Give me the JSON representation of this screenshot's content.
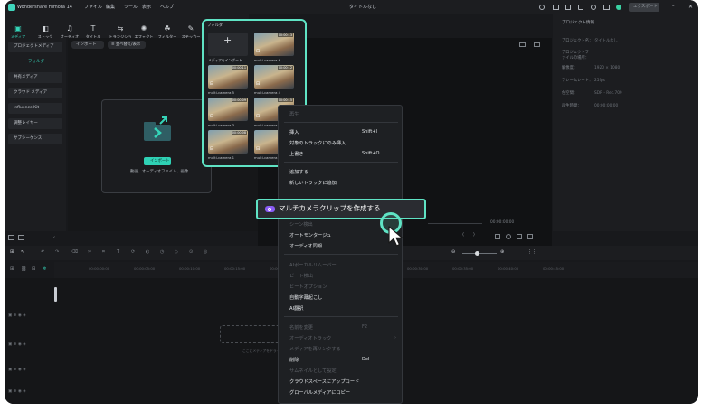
{
  "app": {
    "title": "Wondershare Filmora 14",
    "window_title": "タイトルなし",
    "export_label": "エクスポート"
  },
  "menubar": [
    "ファイル",
    "編集",
    "ツール",
    "表示",
    "ヘルプ"
  ],
  "toolbar": [
    {
      "label": "メディア",
      "icon": "media-icon",
      "glyph": "▣"
    },
    {
      "label": "ストック",
      "icon": "stock-icon",
      "glyph": "◧"
    },
    {
      "label": "オーディオ",
      "icon": "audio-icon",
      "glyph": "♫"
    },
    {
      "label": "タイトル",
      "icon": "title-icon",
      "glyph": "T"
    },
    {
      "label": "トランジション",
      "icon": "transition-icon",
      "glyph": "⇆"
    },
    {
      "label": "エフェクト",
      "icon": "effect-icon",
      "glyph": "✺"
    },
    {
      "label": "フィルター",
      "icon": "filter-icon",
      "glyph": "☘"
    },
    {
      "label": "ステッカー",
      "icon": "sticker-icon",
      "glyph": "✎"
    }
  ],
  "sidebar": {
    "items": [
      {
        "label": "プロジェクトメディア"
      },
      {
        "label": "フォルダ"
      },
      {
        "label": "共有メディア"
      },
      {
        "label": "クラウド メディア"
      },
      {
        "label": "Influence Kit"
      },
      {
        "label": "調整レイヤー"
      },
      {
        "label": "サブシーケンス"
      }
    ]
  },
  "media": {
    "import_chip": "インポート",
    "filter_chip": "≡ 並べ替え/表示",
    "import_button": "インポート",
    "drop_hint": "動画、オーディオファイル、画像"
  },
  "popup": {
    "header": "フォルダ",
    "import_label": "メディアをインポート",
    "thumbs": [
      {
        "label": "multi-camera 6",
        "duration": "00:00:13"
      },
      {
        "label": "multi-camera 5",
        "duration": "00:00:11"
      },
      {
        "label": "multi-camera 4",
        "duration": "00:00:12"
      },
      {
        "label": "multi-camera 3",
        "duration": "00:00:09"
      },
      {
        "label": "multi-camera 2",
        "duration": "00:00:15"
      },
      {
        "label": "multi-camera 1",
        "duration": "00:00:08"
      },
      {
        "label": "multi-camera",
        "duration": "00:00:10"
      }
    ]
  },
  "properties": {
    "header": "プロジェクト情報",
    "rows": [
      {
        "key": "プロジェクト名：",
        "value": "タイトルなし"
      },
      {
        "key": "プロジェクトファイルの場所：",
        "value": ""
      },
      {
        "key": "解像度：",
        "value": "1920 × 1080"
      },
      {
        "key": "フレームレート：",
        "value": "25fps"
      },
      {
        "key": "色空間：",
        "value": "SDR - Rec.709"
      },
      {
        "key": "再生時間：",
        "value": "00:00:00:00"
      }
    ]
  },
  "player": {
    "timecode": "00:00:00:00"
  },
  "ruler": [
    "00:00:00:00",
    "00:00:05:00",
    "00:00:10:00",
    "00:00:15:00",
    "00:00:20:00",
    "00:00:25:00",
    "00:00:30:00",
    "00:00:35:00",
    "00:00:40:00",
    "00:00:45:00"
  ],
  "timeline": {
    "drop_hint": "ここにメディアをドラッグ"
  },
  "context_menu": {
    "items": [
      {
        "label": "再生",
        "disabled": true,
        "shortcut": ""
      },
      {
        "label": "挿入",
        "disabled": false,
        "shortcut": "Shift+I"
      },
      {
        "label": "対象のトラックにのみ挿入",
        "disabled": false,
        "shortcut": ""
      },
      {
        "label": "上書き",
        "disabled": false,
        "shortcut": "Shift+O"
      },
      {
        "label": "追加する",
        "disabled": false,
        "shortcut": ""
      },
      {
        "label": "新しいトラックに追加",
        "disabled": false,
        "shortcut": ""
      },
      {
        "label": "シーン検出",
        "disabled": true,
        "shortcut": ""
      },
      {
        "label": "オートモンタージュ",
        "disabled": false,
        "shortcut": ""
      },
      {
        "label": "オーディオ同期",
        "disabled": false,
        "shortcut": ""
      },
      {
        "label": "AIボーカルリムーバー",
        "disabled": true,
        "shortcut": ""
      },
      {
        "label": "ビート検出",
        "disabled": true,
        "shortcut": ""
      },
      {
        "label": "ビートオプション",
        "disabled": true,
        "shortcut": ""
      },
      {
        "label": "自動字幕起こし",
        "disabled": false,
        "shortcut": ""
      },
      {
        "label": "AI翻訳",
        "disabled": false,
        "shortcut": ""
      },
      {
        "label": "名前を変更",
        "disabled": true,
        "shortcut": "F2"
      },
      {
        "label": "オーディオトラック",
        "disabled": true,
        "shortcut": "›"
      },
      {
        "label": "メディアを再リンクする",
        "disabled": true,
        "shortcut": ""
      },
      {
        "label": "削除",
        "disabled": false,
        "shortcut": "Del"
      },
      {
        "label": "サムネイルとして設定",
        "disabled": true,
        "shortcut": ""
      },
      {
        "label": "クラウドスペースにアップロード",
        "disabled": false,
        "shortcut": ""
      },
      {
        "label": "グローバルメディアにコピー",
        "disabled": false,
        "shortcut": ""
      }
    ],
    "highlighted": "マルチカメラクリップを作成する"
  },
  "colors": {
    "accent": "#5fe3c4",
    "background": "#18191c",
    "panel": "#1c1d20"
  }
}
